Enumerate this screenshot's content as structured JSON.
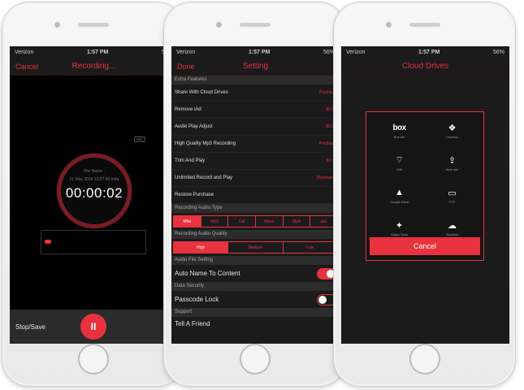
{
  "status": {
    "carrier": "Verizon",
    "time": "1:57 PM",
    "battery": "56%"
  },
  "recording": {
    "cancel_label": "Cancel",
    "title": "Recording...",
    "badge": "REC",
    "file_name_label": "File Name :",
    "file_date": "21 May 2016 13:57:40.m4a",
    "timer": "00:00:02",
    "stop_save_label": "Stop/Save",
    "pause_icon": "pause-icon"
  },
  "setting": {
    "done_label": "Done",
    "title": "Setting",
    "extra_features": {
      "header": "Extra Features",
      "items": [
        {
          "label": "Share With Cloud Drives",
          "price": "Purchase"
        },
        {
          "label": "Remove iAd",
          "price": "$0.99"
        },
        {
          "label": "Audio Play Adjust",
          "price": "$0.99"
        },
        {
          "label": "High Quality Mp3 Recording",
          "price": "Purchase"
        },
        {
          "label": "Trim And Play",
          "price": "$0.99"
        },
        {
          "label": "Unlimited Record and Play",
          "price": "Purchased"
        },
        {
          "label": "Restore Purchase",
          "price": ""
        }
      ]
    },
    "audio_type": {
      "header": "Recording Audio Type",
      "options": [
        "M4a",
        "Mp3",
        "Caf",
        "Wave",
        "Mp4",
        "aac"
      ],
      "selected": "M4a"
    },
    "audio_quality": {
      "header": "Recording Audio Quality",
      "options": [
        "High",
        "Medium",
        "Low"
      ],
      "selected": "High"
    },
    "file_setting": {
      "header": "Audio File Setting",
      "auto_name_label": "Auto Name To Content",
      "auto_name_on": true
    },
    "security": {
      "header": "Data Security",
      "passcode_label": "Passcode Lock",
      "passcode_on": false
    },
    "support": {
      "header": "Support",
      "tell_friend_label": "Tell A Friend"
    }
  },
  "cloud": {
    "title": "Cloud Drives",
    "drives": [
      {
        "icon": "box-icon",
        "glyph": "box",
        "label": "Box.net"
      },
      {
        "icon": "dropbox-icon",
        "glyph": "❖",
        "label": "Dropbox"
      },
      {
        "icon": "wifi-icon",
        "glyph": "⌔",
        "label": "Wifi"
      },
      {
        "icon": "webdav-icon",
        "glyph": "⇪",
        "label": "Web dav"
      },
      {
        "icon": "google-drive-icon",
        "glyph": "▲",
        "label": "Google Drive"
      },
      {
        "icon": "ftp-icon",
        "glyph": "▭",
        "label": "FTP"
      },
      {
        "icon": "sugarsync-icon",
        "glyph": "✦",
        "label": "Sugar Sync"
      },
      {
        "icon": "skydrive-icon",
        "glyph": "☁",
        "label": "Skydrive"
      }
    ],
    "cancel_label": "Cancel"
  },
  "colors": {
    "accent": "#e8323f",
    "background": "#1b1b1b"
  }
}
